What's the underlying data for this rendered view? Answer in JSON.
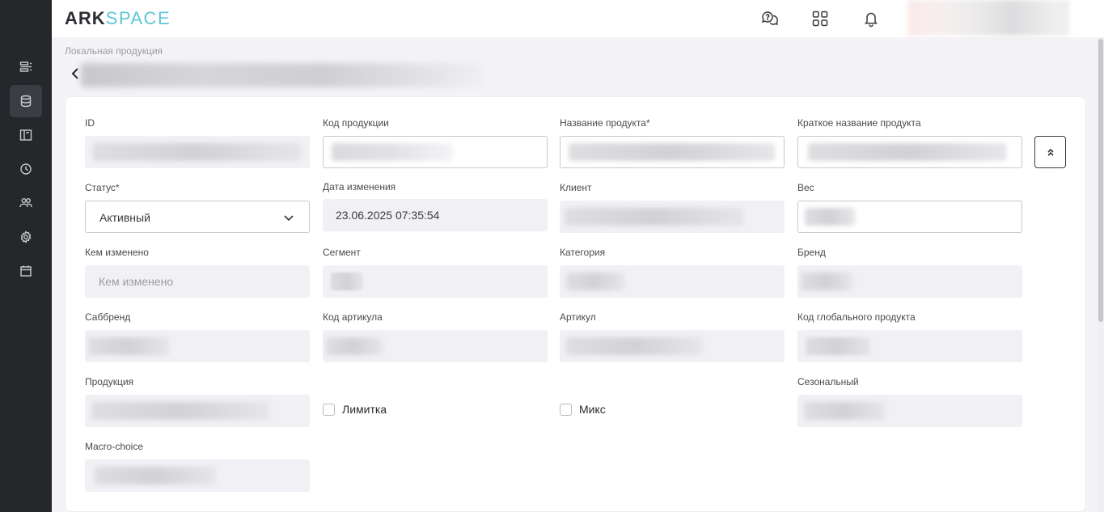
{
  "app": {
    "logo_part1": "ARK",
    "logo_part2": "SPACE"
  },
  "breadcrumb": "Локальная продукция",
  "fields": {
    "id": {
      "label": "ID"
    },
    "product_code": {
      "label": "Код продукции"
    },
    "product_name": {
      "label": "Название продукта*"
    },
    "short_name": {
      "label": "Краткое название продукта"
    },
    "status": {
      "label": "Статус*",
      "value": "Активный"
    },
    "modified_date": {
      "label": "Дата изменения",
      "value": "23.06.2025 07:35:54"
    },
    "client": {
      "label": "Клиент"
    },
    "weight": {
      "label": "Вес"
    },
    "modified_by": {
      "label": "Кем изменено",
      "placeholder": "Кем изменено"
    },
    "segment": {
      "label": "Сегмент"
    },
    "category": {
      "label": "Категория"
    },
    "brand": {
      "label": "Бренд"
    },
    "subbrand": {
      "label": "Саббренд"
    },
    "article_code": {
      "label": "Код артикула"
    },
    "article": {
      "label": "Артикул"
    },
    "global_product_code": {
      "label": "Код глобального продукта"
    },
    "production": {
      "label": "Продукция"
    },
    "limited": {
      "label": "Лимитка",
      "checked": false
    },
    "mix": {
      "label": "Микс",
      "checked": false
    },
    "seasonal": {
      "label": "Сезональный"
    },
    "macro_choice": {
      "label": "Macro-choice"
    }
  },
  "icons": {
    "sidebar": [
      "list-icon",
      "database-icon",
      "layout-icon",
      "clock-icon",
      "users-icon",
      "gear-icon",
      "calendar-icon"
    ],
    "topbar": [
      "help-chat-icon",
      "apps-grid-icon",
      "bell-icon"
    ]
  },
  "colors": {
    "sidebar_bg": "#25272b",
    "logo_accent": "#5fc6d3",
    "page_bg": "#f4f4f8"
  }
}
